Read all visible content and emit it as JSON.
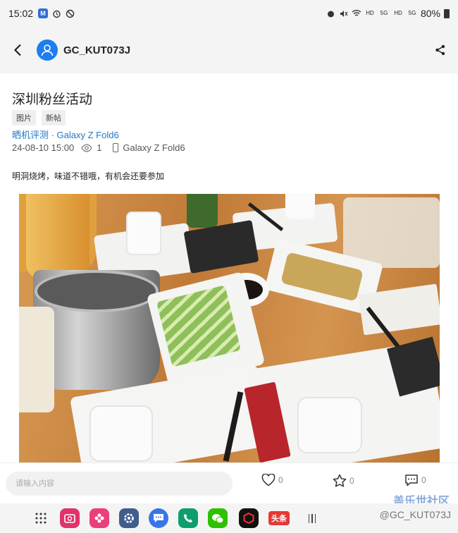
{
  "status_bar": {
    "time": "15:02",
    "battery": "80%",
    "signal_labels": [
      "HD",
      "5G",
      "HD",
      "5G"
    ]
  },
  "header": {
    "username": "GC_KUT073J"
  },
  "post": {
    "title": "深圳粉丝活动",
    "tags": [
      "图片",
      "新帖"
    ],
    "category": "晒机评测 · Galaxy Z Fold6",
    "date": "24-08-10 15:00",
    "views": "1",
    "device": "Galaxy Z Fold6",
    "body": "明洞烧烤，味道不错哦，有机会还要参加"
  },
  "bottom_bar": {
    "comment_placeholder": "请输入内容",
    "likes": "0",
    "favorites": "0",
    "comments": "0"
  },
  "dock": {
    "toutiao_label": "头条"
  },
  "watermark": {
    "brand": "盖乐世社区",
    "user": "@GC_KUT073J"
  },
  "colors": {
    "accent": "#1f78c8",
    "avatar": "#1e7df0",
    "table": "#c8853e"
  }
}
